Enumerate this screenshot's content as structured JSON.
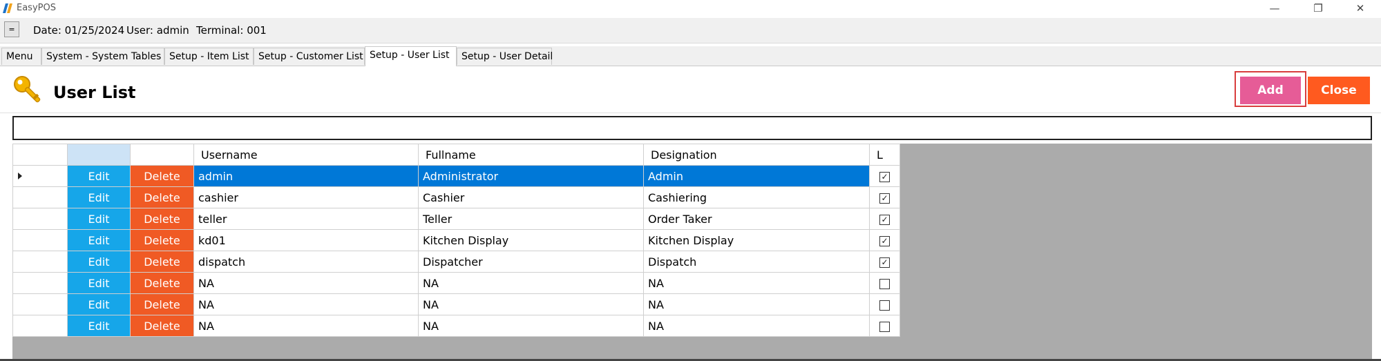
{
  "window": {
    "title": "EasyPOS",
    "minimize_glyph": "—",
    "restore_glyph": "❐",
    "close_glyph": "✕"
  },
  "infobar": {
    "menu_glyph": "=",
    "date": "Date: 01/25/2024",
    "user": "User: admin",
    "terminal": "Terminal: 001"
  },
  "tabs": [
    {
      "label": "Menu"
    },
    {
      "label": "System - System Tables"
    },
    {
      "label": "Setup - Item List"
    },
    {
      "label": "Setup - Customer List"
    },
    {
      "label": "Setup - User List",
      "active": true
    },
    {
      "label": "Setup - User Detail"
    }
  ],
  "page": {
    "title": "User List",
    "icon": "key-icon",
    "add_label": "Add",
    "close_label": "Close",
    "search_value": ""
  },
  "grid": {
    "columns": {
      "username": "Username",
      "fullname": "Fullname",
      "designation": "Designation",
      "locked": "L"
    },
    "edit_label": "Edit",
    "delete_label": "Delete",
    "rows": [
      {
        "username": "admin",
        "fullname": "Administrator",
        "designation": "Admin",
        "locked": true,
        "selected": true
      },
      {
        "username": "cashier",
        "fullname": "Cashier",
        "designation": "Cashiering",
        "locked": true
      },
      {
        "username": "teller",
        "fullname": "Teller",
        "designation": "Order Taker",
        "locked": true
      },
      {
        "username": "kd01",
        "fullname": "Kitchen Display",
        "designation": "Kitchen Display",
        "locked": true
      },
      {
        "username": "dispatch",
        "fullname": "Dispatcher",
        "designation": "Dispatch",
        "locked": true
      },
      {
        "username": "NA",
        "fullname": "NA",
        "designation": "NA",
        "locked": false
      },
      {
        "username": "NA",
        "fullname": "NA",
        "designation": "NA",
        "locked": false
      },
      {
        "username": "NA",
        "fullname": "NA",
        "designation": "NA",
        "locked": false
      }
    ]
  },
  "colors": {
    "add_button": "#e65c97",
    "close_button": "#ff5a1f",
    "edit_button": "#16a6e9",
    "delete_button": "#f05a24",
    "selection": "#0078d7"
  }
}
